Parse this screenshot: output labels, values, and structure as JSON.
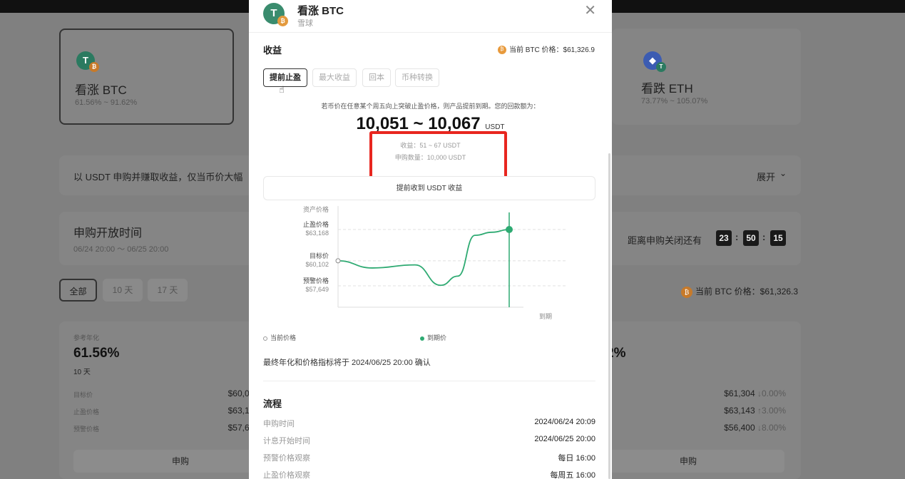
{
  "background": {
    "card_up": {
      "name": "看涨 BTC",
      "range": "61.56% ~ 91.62%"
    },
    "card_down": {
      "name": "看跌 ETH",
      "range": "73.77% ~ 105.07%"
    },
    "banner": {
      "text": "以 USDT 申购并赚取收益，仅当币价大幅",
      "expand": "展开"
    },
    "subscribe_window": {
      "title": "申购开放时间",
      "range": "06/24 20:00 ～ 06/25 20:00",
      "countdown_label": "距离申购关闭还有",
      "hh": "23",
      "mm": "50",
      "ss": "15"
    },
    "filters": [
      "全部",
      "10 天",
      "17 天"
    ],
    "current_price": "当前 BTC 价格：$61,326.3",
    "left_product": {
      "ref_label": "参考年化",
      "apy": "61.56%",
      "term": "10 天",
      "rows": [
        {
          "k": "目标价",
          "v": "$60,078"
        },
        {
          "k": "止盈价格",
          "v": "$63,143"
        },
        {
          "k": "预警价格",
          "v": "$57,626"
        }
      ],
      "button": "申购"
    },
    "right_product": {
      "apy_partial": "2%",
      "rows": [
        {
          "v": "$61,304",
          "delta": "↓0.00%"
        },
        {
          "v": "$63,143",
          "delta": "↑3.00%"
        },
        {
          "v": "$56,400",
          "delta": "↓8.00%"
        }
      ],
      "button": "申购"
    }
  },
  "modal": {
    "title": "看涨 BTC",
    "subtitle": "雪球",
    "section_income": "收益",
    "btc_price": "当前 BTC 价格：$61,326.9",
    "tabs": [
      "提前止盈",
      "最大收益",
      "回本",
      "币种转换"
    ],
    "description": "若币价在任意某个周五向上突破止盈价格，则产品提前到期。您的回款额为：",
    "return_range": "10,051 ~ 10,067",
    "return_unit": "USDT",
    "income": "收益：51 ~ 67 USDT",
    "amount": "申购数量：10,000 USDT",
    "early_button": "提前收到 USDT 收益",
    "chart_data": {
      "type": "line",
      "ylabel": "资产价格",
      "xlabel_end": "到期",
      "levels": [
        {
          "name": "止盈价格",
          "value": 63168
        },
        {
          "name": "目标价",
          "value": 60102
        },
        {
          "name": "预警价格",
          "value": 57649
        }
      ],
      "value_labels": [
        "$63,168",
        "$60,102",
        "$57,649"
      ],
      "series": [
        {
          "x": [
            0,
            0.2,
            0.45,
            0.6,
            0.7,
            0.8,
            0.9,
            1.0
          ],
          "y": [
            60102,
            59400,
            59700,
            57700,
            58600,
            62600,
            62900,
            63168
          ]
        }
      ],
      "start_marker": "当前价格",
      "end_marker": "到期价"
    },
    "legend_current": "当前价格",
    "legend_expiry": "到期价",
    "final_note": "最终年化和价格指标将于 2024/06/25 20:00 确认",
    "flow_title": "流程",
    "flow": [
      {
        "k": "申购时间",
        "v": "2024/06/24 20:09"
      },
      {
        "k": "计息开始时间",
        "v": "2024/06/25 20:00"
      },
      {
        "k": "预警价格观察",
        "v": "每日 16:00"
      },
      {
        "k": "止盈价格观察",
        "v": "每周五 16:00"
      }
    ],
    "colors": {
      "accent": "#2eaa72",
      "highlight": "#e8261f"
    }
  }
}
